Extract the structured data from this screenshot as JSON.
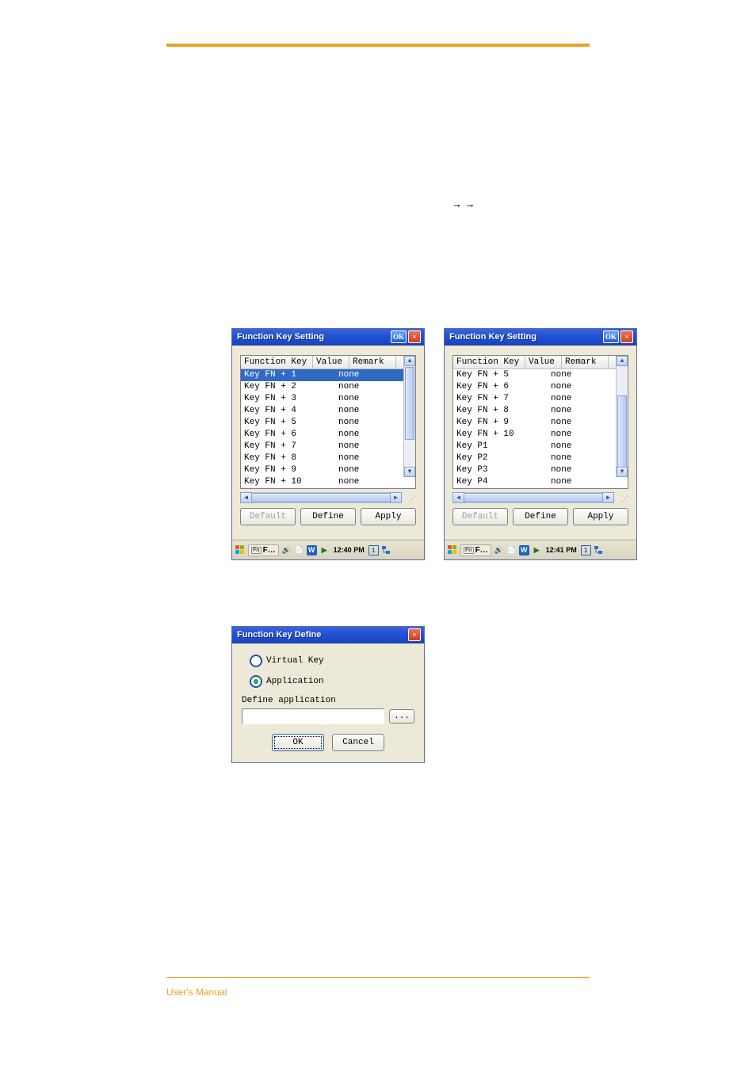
{
  "arrows_line": "→          →",
  "footer": "User's Manual",
  "win1": {
    "title": "Function Key Setting",
    "ok": "OK",
    "close": "×",
    "headers": {
      "key": "Function Key",
      "val": "Value",
      "rem": "Remark"
    },
    "rows": [
      {
        "key": "Key FN + 1",
        "val": "",
        "rem": "none",
        "sel": true
      },
      {
        "key": "Key FN + 2",
        "val": "",
        "rem": "none",
        "sel": false
      },
      {
        "key": "Key FN + 3",
        "val": "",
        "rem": "none",
        "sel": false
      },
      {
        "key": "Key FN + 4",
        "val": "",
        "rem": "none",
        "sel": false
      },
      {
        "key": "Key FN + 5",
        "val": "",
        "rem": "none",
        "sel": false
      },
      {
        "key": "Key FN + 6",
        "val": "",
        "rem": "none",
        "sel": false
      },
      {
        "key": "Key FN + 7",
        "val": "",
        "rem": "none",
        "sel": false
      },
      {
        "key": "Key FN + 8",
        "val": "",
        "rem": "none",
        "sel": false
      },
      {
        "key": "Key FN + 9",
        "val": "",
        "rem": "none",
        "sel": false
      },
      {
        "key": "Key FN + 10",
        "val": "",
        "rem": "none",
        "sel": false
      }
    ],
    "buttons": {
      "default": "Default",
      "define": "Define",
      "apply": "Apply"
    },
    "taskbar": {
      "task": "F…",
      "time": "12:40 PM"
    }
  },
  "win2": {
    "title": "Function Key Setting",
    "ok": "OK",
    "close": "×",
    "headers": {
      "key": "Function Key",
      "val": "Value",
      "rem": "Remark"
    },
    "rows": [
      {
        "key": "Key FN + 5",
        "val": "",
        "rem": "none",
        "sel": false
      },
      {
        "key": "Key FN + 6",
        "val": "",
        "rem": "none",
        "sel": false
      },
      {
        "key": "Key FN + 7",
        "val": "",
        "rem": "none",
        "sel": false
      },
      {
        "key": "Key FN + 8",
        "val": "",
        "rem": "none",
        "sel": false
      },
      {
        "key": "Key FN + 9",
        "val": "",
        "rem": "none",
        "sel": false
      },
      {
        "key": "Key FN + 10",
        "val": "",
        "rem": "none",
        "sel": false
      },
      {
        "key": "Key P1",
        "val": "",
        "rem": "none",
        "sel": false
      },
      {
        "key": "Key P2",
        "val": "",
        "rem": "none",
        "sel": false
      },
      {
        "key": "Key P3",
        "val": "",
        "rem": "none",
        "sel": false
      },
      {
        "key": "Key P4",
        "val": "",
        "rem": "none",
        "sel": false
      }
    ],
    "buttons": {
      "default": "Default",
      "define": "Define",
      "apply": "Apply"
    },
    "taskbar": {
      "task": "F…",
      "time": "12:41 PM"
    }
  },
  "define": {
    "title": "Function Key Define",
    "close": "×",
    "radio1": "Virtual Key",
    "radio2": "Application",
    "label": "Define application",
    "browse": "...",
    "ok": "OK",
    "cancel": "Cancel"
  }
}
